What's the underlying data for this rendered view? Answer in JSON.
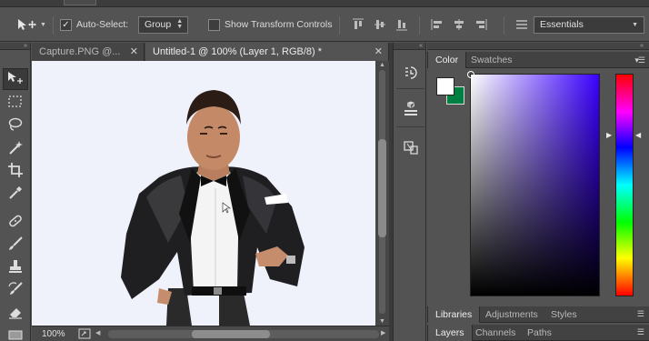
{
  "options_bar": {
    "auto_select_label": "Auto-Select:",
    "auto_select_checked": true,
    "auto_select_target": "Group",
    "show_transform_label": "Show Transform Controls",
    "show_transform_checked": false,
    "workspace": "Essentials"
  },
  "document_tabs": [
    {
      "label": "Capture.PNG @...",
      "active": false
    },
    {
      "label": "Untitled-1 @ 100% (Layer 1, RGB/8) *",
      "active": true
    }
  ],
  "status": {
    "zoom": "100%"
  },
  "color_panel": {
    "tabs": [
      "Color",
      "Swatches"
    ],
    "active_tab": "Color",
    "foreground_color": "#ffffff",
    "background_color": "#008040",
    "hue_color": "#3a00ff"
  },
  "libraries_group": {
    "tabs": [
      "Libraries",
      "Adjustments",
      "Styles"
    ],
    "active_tab": "Libraries"
  },
  "layers_group": {
    "tabs": [
      "Layers",
      "Channels",
      "Paths"
    ],
    "active_tab": "Layers"
  },
  "tools": [
    "move-tool-icon",
    "marquee-tool-icon",
    "lasso-tool-icon",
    "magic-wand-tool-icon",
    "crop-tool-icon",
    "eyedropper-tool-icon",
    "healing-brush-tool-icon",
    "brush-tool-icon",
    "clone-stamp-tool-icon",
    "history-brush-tool-icon",
    "eraser-tool-icon"
  ]
}
